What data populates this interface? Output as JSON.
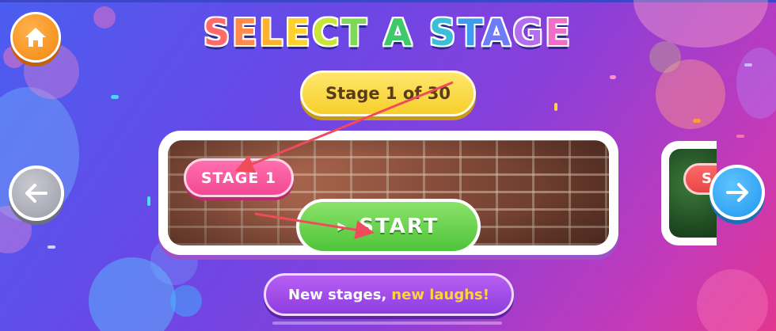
{
  "title": {
    "letters": [
      {
        "ch": "S",
        "color": "#ff6b6b"
      },
      {
        "ch": "E",
        "color": "#ff8a4c"
      },
      {
        "ch": "L",
        "color": "#ffb02e"
      },
      {
        "ch": "E",
        "color": "#ffd12e"
      },
      {
        "ch": "C",
        "color": "#c8e63a"
      },
      {
        "ch": "T",
        "color": "#7ed957"
      },
      {
        "ch": " ",
        "color": "#ffffff"
      },
      {
        "ch": "A",
        "color": "#3ec96b"
      },
      {
        "ch": " ",
        "color": "#ffffff"
      },
      {
        "ch": "S",
        "color": "#3bbfd9"
      },
      {
        "ch": "T",
        "color": "#3d9cf0"
      },
      {
        "ch": "A",
        "color": "#6e7cf5"
      },
      {
        "ch": "G",
        "color": "#b46ef0"
      },
      {
        "ch": "E",
        "color": "#ef6fc8"
      }
    ]
  },
  "stage_counter": "Stage 1 of 30",
  "current_stage": {
    "tag": "STAGE 1",
    "start_label": "START"
  },
  "next_stage": {
    "tag_partial": "S"
  },
  "banner": {
    "text": "New stages,",
    "accent_text": "new laughs!"
  },
  "icons": {
    "home": "home-icon",
    "prev": "arrow-left-icon",
    "next": "arrow-right-icon",
    "play": "play-icon"
  },
  "colors": {
    "home_button": "#f79422",
    "counter_pill": "#f7cf2c",
    "stage_tag": "#f24893",
    "start_button": "#4fc43a",
    "next_arrow": "#2196f0",
    "prev_arrow": "#9c9ca8",
    "banner": "#8d3de0",
    "banner_accent": "#ffd43b",
    "annotation_arrow": "#f04b5a"
  }
}
